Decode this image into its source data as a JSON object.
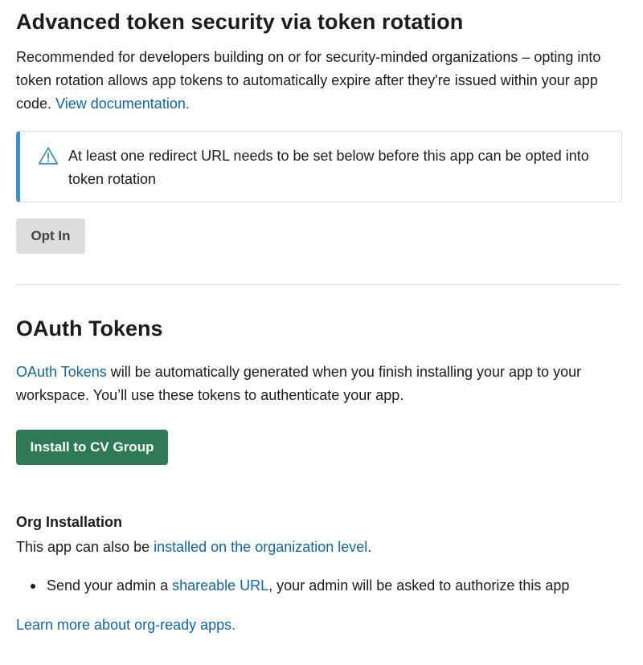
{
  "token_rotation": {
    "title": "Advanced token security via token rotation",
    "description_text": "Recommended for developers building on or for security-minded organizations – opting into token rotation allows app tokens to automatically expire after they're issued within your app code.",
    "doc_link": "View documentation.",
    "callout": {
      "icon": "warning-triangle-icon",
      "text": "At least one redirect URL needs to be set below before this app can be opted into token rotation"
    },
    "opt_in_label": "Opt In"
  },
  "oauth_tokens": {
    "title": "OAuth Tokens",
    "link_text": "OAuth Tokens",
    "description_rest": " will be automatically generated when you finish installing your app to your workspace. You’ll use these tokens to authenticate your app.",
    "install_label": "Install to CV Group"
  },
  "org_installation": {
    "title": "Org Installation",
    "desc_prefix": "This app can also be ",
    "desc_link": "installed on the organization level",
    "desc_suffix": ".",
    "bullet_prefix": "Send your admin a ",
    "bullet_link": "shareable URL",
    "bullet_suffix": ", your admin will be asked to authorize this app",
    "learn_more": "Learn more about org-ready apps."
  },
  "colors": {
    "link": "#1264a3",
    "install_button": "#2e7a54",
    "callout_accent": "#3f8fcf",
    "opt_in_button": "#dddddd"
  }
}
